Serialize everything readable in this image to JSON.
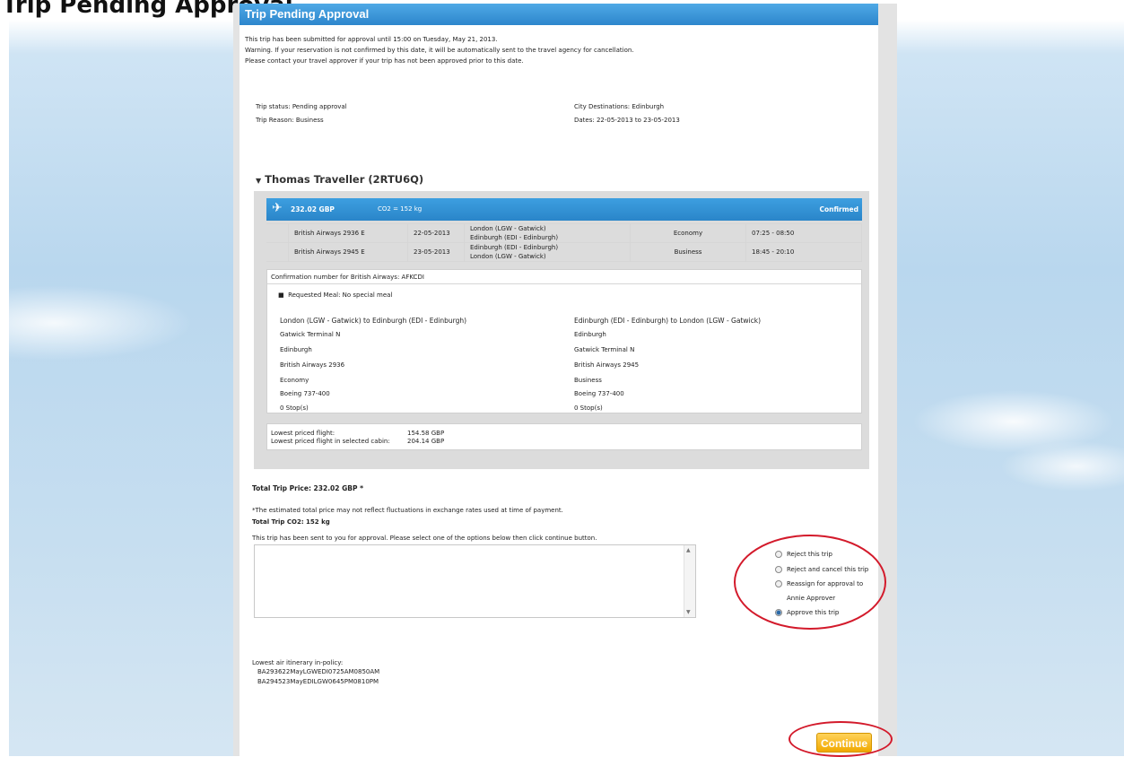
{
  "page_heading": "Trip Pending Approval",
  "panel_title": "Trip Pending Approval",
  "intro_lines": [
    "This trip has been submitted for approval until 15:00 on Tuesday, May 21, 2013.",
    "Warning. If your reservation is not confirmed by this date, it will be automatically sent to the travel agency for cancellation.",
    "Please contact your travel approver if your trip has not been approved prior to this date."
  ],
  "trip_status": "Trip status: Pending approval",
  "trip_reason": "Trip Reason: Business",
  "city_destinations": "City Destinations: Edinburgh",
  "dates": "Dates: 22-05-2013 to 23-05-2013",
  "traveller_name": "Thomas Traveller  (2RTU6Q)",
  "segment": {
    "price": "232.02 GBP",
    "co2": "CO2 = 152 kg",
    "status": "Confirmed"
  },
  "flights": [
    {
      "airline": "British Airways 2936 E",
      "date": "22-05-2013",
      "route_from": "London (LGW - Gatwick)",
      "route_to": "Edinburgh (EDI - Edinburgh)",
      "cabin": "Economy",
      "time": "07:25 - 08:50"
    },
    {
      "airline": "British Airways 2945 E",
      "date": "23-05-2013",
      "route_from": "Edinburgh (EDI - Edinburgh)",
      "route_to": "London (LGW - Gatwick)",
      "cabin": "Business",
      "time": "18:45 - 20:10"
    }
  ],
  "confirmation_number": "Confirmation number for British Airways: AFKCDI",
  "requested_meal": "Requested Meal: No special meal",
  "outbound": {
    "heading": "London (LGW - Gatwick) to Edinburgh (EDI - Edinburgh)",
    "lines": [
      "Gatwick Terminal  N",
      "Edinburgh",
      "British Airways  2936",
      "Economy",
      "Boeing 737-400",
      "0 Stop(s)"
    ]
  },
  "return": {
    "heading": "Edinburgh (EDI - Edinburgh) to London (LGW - Gatwick)",
    "lines": [
      "Edinburgh",
      "Gatwick Terminal  N",
      "British Airways  2945",
      "Business",
      "Boeing 737-400",
      "0 Stop(s)"
    ]
  },
  "lowest": {
    "label1": "Lowest priced flight:",
    "value1": "154.58 GBP",
    "label2": "Lowest priced flight in selected cabin:",
    "value2": "204.14 GBP"
  },
  "total_price": "Total Trip Price: 232.02 GBP *",
  "disclaimer": "*The estimated total price may not reflect fluctuations in exchange rates used at time of payment.",
  "total_co2": "Total Trip CO2: 152 kg",
  "approval_instruction": "This trip has been sent to you for approval. Please select one of the options below then click continue button.",
  "comment_value": "",
  "options": [
    {
      "label": "Reject this trip",
      "checked": false
    },
    {
      "label": "Reject and cancel this trip",
      "checked": false
    },
    {
      "label": "Reassign for approval to",
      "checked": false
    },
    {
      "label": "Approve this trip",
      "checked": true
    }
  ],
  "reassign_to": "Annie Approver",
  "lowest_itinerary_label": "Lowest air itinerary in-policy:",
  "lowest_itinerary_lines": [
    "BA293622MayLGWEDI0725AM0850AM",
    "BA294523MayEDILGW0645PM0810PM"
  ],
  "continue_label": "Continue",
  "colors": {
    "title_blue": "#2d86cc",
    "continue_orange": "#f0a800",
    "annotation_red": "#d31a2b"
  }
}
